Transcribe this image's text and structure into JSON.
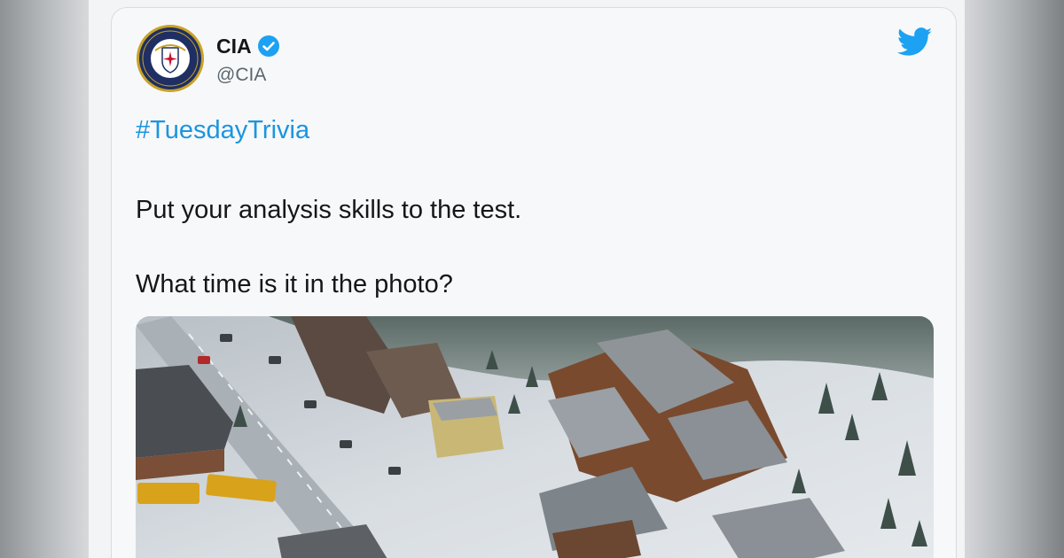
{
  "tweet": {
    "author_name": "CIA",
    "handle": "@CIA",
    "verified": true,
    "hashtag": "#TuesdayTrivia",
    "lines": [
      "Put your analysis skills to the test.",
      "What time is it in the photo?"
    ],
    "icons": {
      "verified": "verified-badge-icon",
      "brand": "twitter-bird-icon",
      "avatar": "cia-seal-avatar"
    }
  },
  "colors": {
    "link": "#1b95e0",
    "text": "#14171a",
    "muted": "#5b6670",
    "verified": "#1da1f2",
    "twitter_blue": "#1da1f2"
  }
}
